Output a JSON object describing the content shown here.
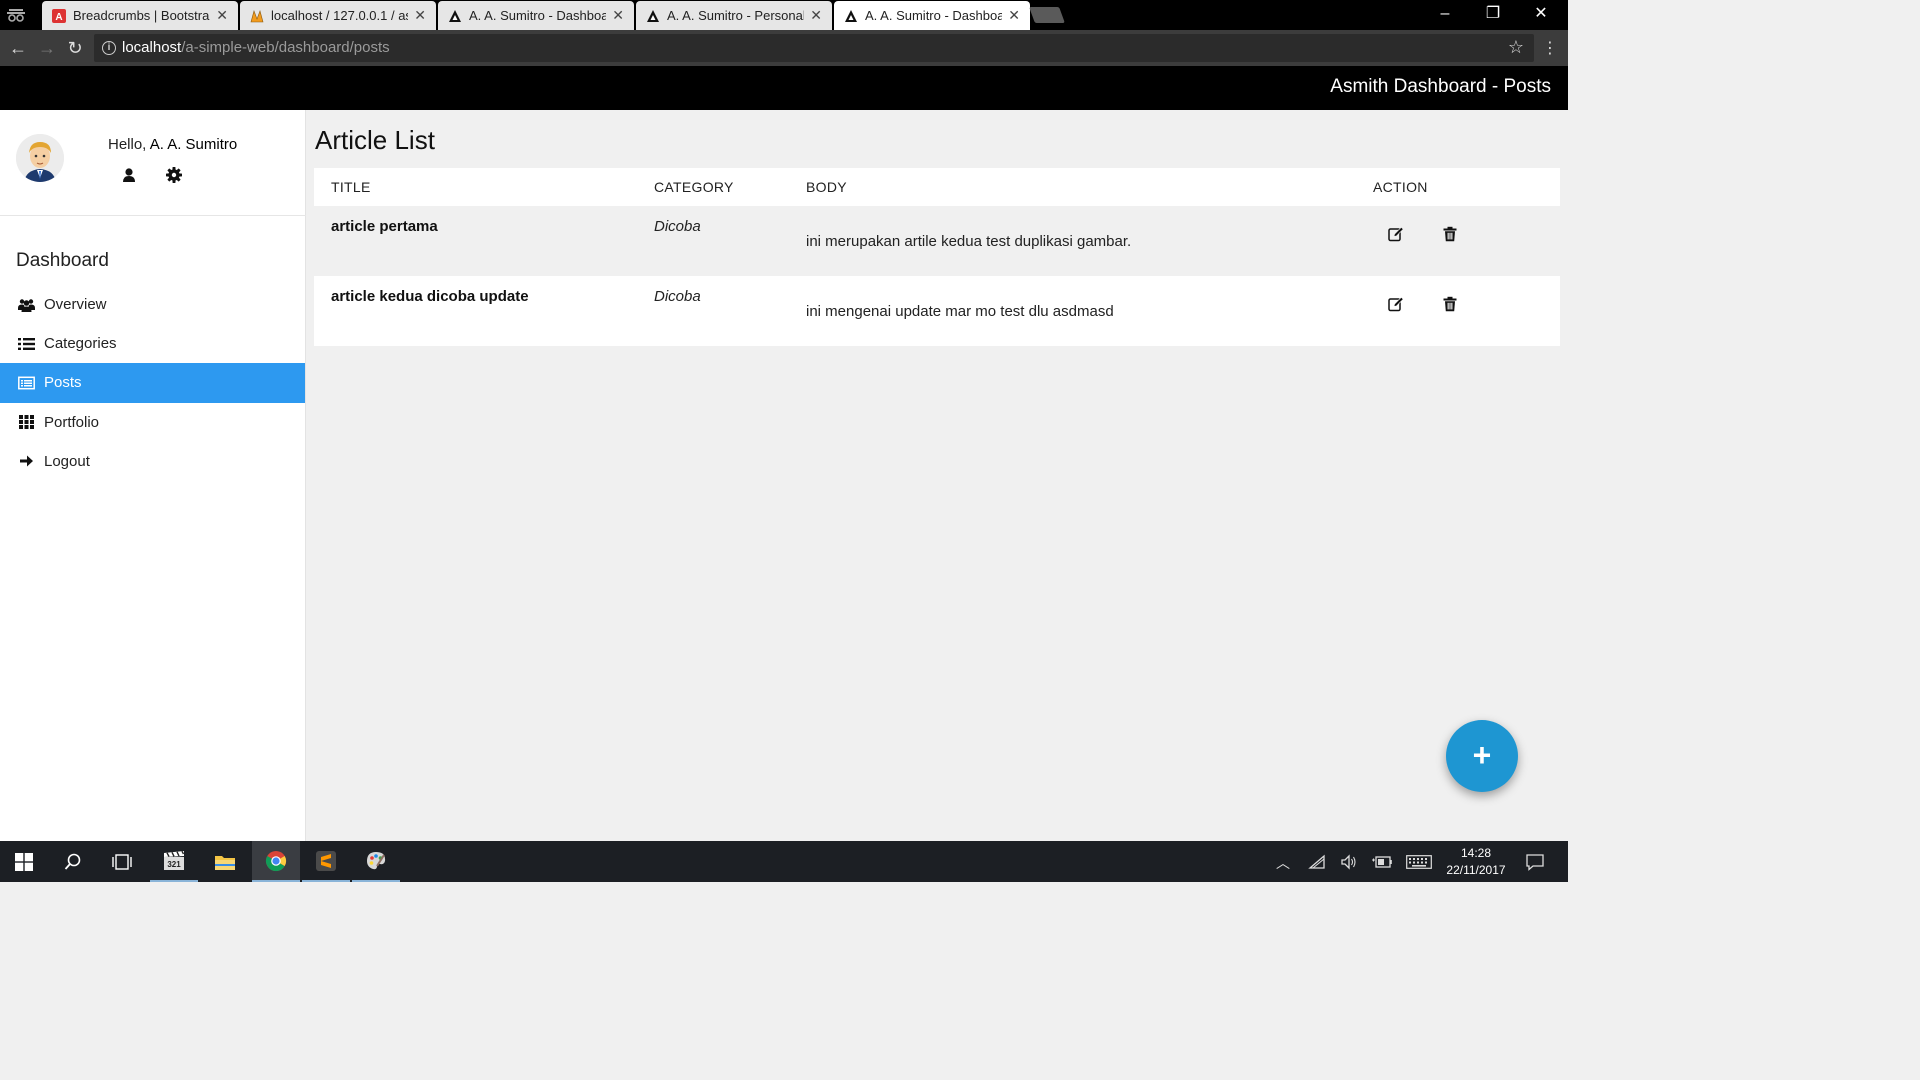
{
  "browser": {
    "tabs": [
      {
        "label": "Breadcrumbs | Bootstrap",
        "icon": "angular-icon",
        "active": false
      },
      {
        "label": "localhost / 127.0.0.1 / as",
        "icon": "phpmyadmin-icon",
        "active": false
      },
      {
        "label": "A. A. Sumitro - Dashboar",
        "icon": "site-icon",
        "active": false
      },
      {
        "label": "A. A. Sumitro - Personal",
        "icon": "site-icon",
        "active": false
      },
      {
        "label": "A. A. Sumitro - Dashboar",
        "icon": "site-icon",
        "active": true
      }
    ],
    "url_host": "localhost",
    "url_path": "/a-simple-web/dashboard/posts"
  },
  "app": {
    "title": "Asmith Dashboard - Posts"
  },
  "sidebar": {
    "greeting": "Hello, ",
    "user_name": "A. A. Sumitro",
    "menu_heading": "Dashboard",
    "items": [
      {
        "label": "Overview",
        "icon": "users-icon"
      },
      {
        "label": "Categories",
        "icon": "list-icon"
      },
      {
        "label": "Posts",
        "icon": "posts-icon",
        "active": true
      },
      {
        "label": "Portfolio",
        "icon": "grid-icon"
      },
      {
        "label": "Logout",
        "icon": "arrow-right-icon"
      }
    ]
  },
  "main": {
    "title": "Article List",
    "columns": [
      "TITLE",
      "CATEGORY",
      "BODY",
      "ACTION"
    ],
    "rows": [
      {
        "title": "article pertama",
        "category": "Dicoba",
        "body": "ini merupakan artile kedua test duplikasi gambar."
      },
      {
        "title": "article kedua dicoba update",
        "category": "Dicoba",
        "body": "ini mengenai update mar mo test dlu asdmasd"
      }
    ],
    "fab_label": "+"
  },
  "taskbar": {
    "time": "14:28",
    "date": "22/11/2017"
  },
  "colors": {
    "header": "#000000",
    "active_menu": "#2d99f0",
    "fab": "#1e96d2"
  }
}
